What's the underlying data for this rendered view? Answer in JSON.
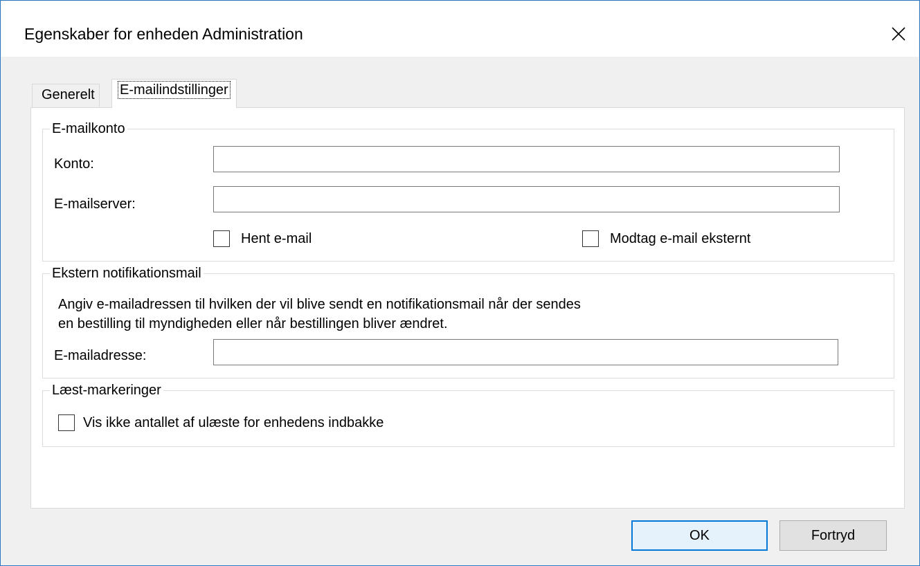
{
  "window": {
    "title": "Egenskaber for enheden Administration"
  },
  "tabs": [
    {
      "label": "Generelt",
      "selected": false
    },
    {
      "label": "E-mailindstillinger",
      "selected": true
    }
  ],
  "email_account": {
    "legend": "E-mailkonto",
    "account_label": "Konto:",
    "account_value": "",
    "server_label": "E-mailserver:",
    "server_value": "",
    "fetch_mail_label": "Hent e-mail",
    "fetch_mail_checked": false,
    "receive_external_label": "Modtag e-mail eksternt",
    "receive_external_checked": false
  },
  "external_notification": {
    "legend": "Ekstern notifikationsmail",
    "description_line1": "Angiv e-mailadressen til hvilken der vil blive sendt en notifikationsmail når der sendes",
    "description_line2": "en bestilling til myndigheden eller når bestillingen bliver ændret.",
    "address_label": "E-mailadresse:",
    "address_value": ""
  },
  "read_markings": {
    "legend": "Læst-markeringer",
    "hide_unread_label": "Vis ikke antallet af ulæste for enhedens indbakke",
    "hide_unread_checked": false
  },
  "buttons": {
    "ok_label": "OK",
    "cancel_label": "Fortryd"
  },
  "icons": {
    "close": "close-icon"
  }
}
